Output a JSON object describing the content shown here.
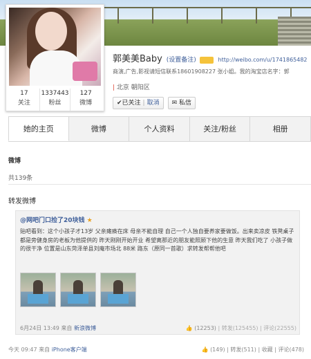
{
  "profile": {
    "name": "郭美美Baby",
    "remark_label": "(设置备注)",
    "url": "http://weibo.com/u/1741865482",
    "bio": "商演,广告,影视请短信联系18601908227 张小姐。我的淘宝店名字：郭",
    "location": "北京 朝阳区",
    "stats": [
      {
        "value": "17",
        "label": "关注"
      },
      {
        "value": "1337443",
        "label": "粉丝"
      },
      {
        "value": "127",
        "label": "微博"
      }
    ],
    "follow_label": "✔已关注",
    "cancel_label": "取消",
    "message_label": "私信"
  },
  "tabs": [
    "她的主页",
    "微博",
    "个人资料",
    "关注/粉丝",
    "相册"
  ],
  "weibo_section": {
    "title": "微博",
    "count_text": "共139条"
  },
  "repost_title": "转发微博",
  "repost": {
    "author": "@网吧门口捡了20块钱",
    "text": "贴吧看到：这个小孩子才13岁 父亲瘫痪在床 母亲不能自理 自己一个人独自要养家要做饭。出来卖凉皮 铁凳桌子都是旁健身房的老板为他提供的 昨天刚刚开始开业 希望离那近的朋友能照顾下他的生意 昨天我们吃了 小孩子做的很干净 位置是山东菏泽单县刘庵市场北 88米 路东（原同一首歌）求转发帮帮他吧",
    "time": "6月24日 13:49",
    "source_prefix": "来自",
    "source": "新浪微博",
    "likes": "(12253)",
    "repost_label": "转发(125455)",
    "comment_label": "评论(22555)"
  },
  "post_footer": {
    "time": "今天 09:47",
    "source_prefix": "来自",
    "source": "iPhone客户端",
    "likes": "(149)",
    "repost_label": "转发(511)",
    "favorite_label": "收藏",
    "comment_label": "评论(478)"
  },
  "colors": {
    "link": "#3f5f9a",
    "tab_bg": "#f2f2f2",
    "repost_bg": "#f2f2f2"
  }
}
